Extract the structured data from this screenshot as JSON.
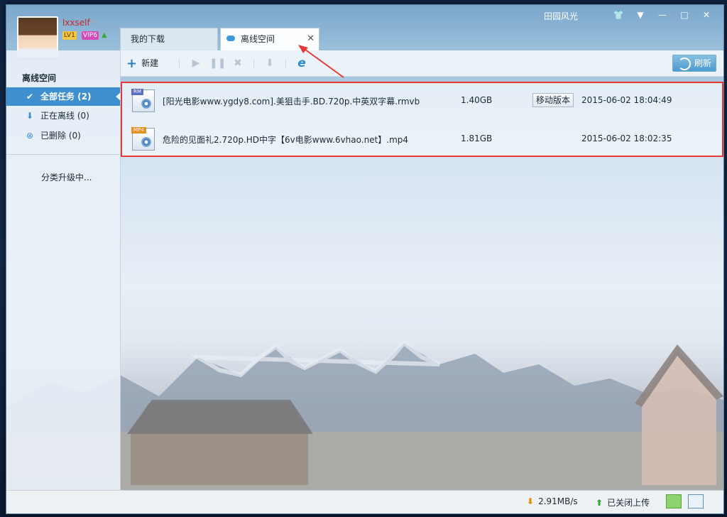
{
  "titlebar": {
    "skin_name": "田园风光",
    "buttons": [
      "shirt-icon",
      "menu-icon",
      "minimize-icon",
      "maximize-icon",
      "close-icon"
    ]
  },
  "user": {
    "name": "lxxself",
    "level": "LV1",
    "vip": "VIP6"
  },
  "tabs": [
    {
      "label": "我的下载"
    },
    {
      "label": "离线空间",
      "active": true
    }
  ],
  "sidebar": {
    "title": "离线空间",
    "items": [
      {
        "label": "全部任务 (2)",
        "icon": "check-icon"
      },
      {
        "label": "正在离线 (0)",
        "icon": "download-arrow-icon"
      },
      {
        "label": "已删除 (0)",
        "icon": "delete-circle-icon"
      }
    ],
    "upgrading": "分类升级中..."
  },
  "toolbar": {
    "new_label": "新建",
    "refresh_label": "刷新"
  },
  "files": [
    {
      "type": "RM",
      "name": "[阳光电影www.ygdy8.com].美狙击手.BD.720p.中英双字幕.rmvb",
      "size": "1.40GB",
      "action": "移动版本",
      "date": "2015-06-02  18:04:49"
    },
    {
      "type": "MP4",
      "name": "危险的见面礼2.720p.HD中字【6v电影www.6vhao.net】.mp4",
      "size": "1.81GB",
      "action": "",
      "date": "2015-06-02  18:02:35"
    }
  ],
  "status": {
    "speed": "2.91MB/s",
    "upload": "已关闭上传"
  },
  "colors": {
    "accent": "#3d8fd0",
    "highlight_border": "#e53935",
    "username": "#c62828"
  }
}
